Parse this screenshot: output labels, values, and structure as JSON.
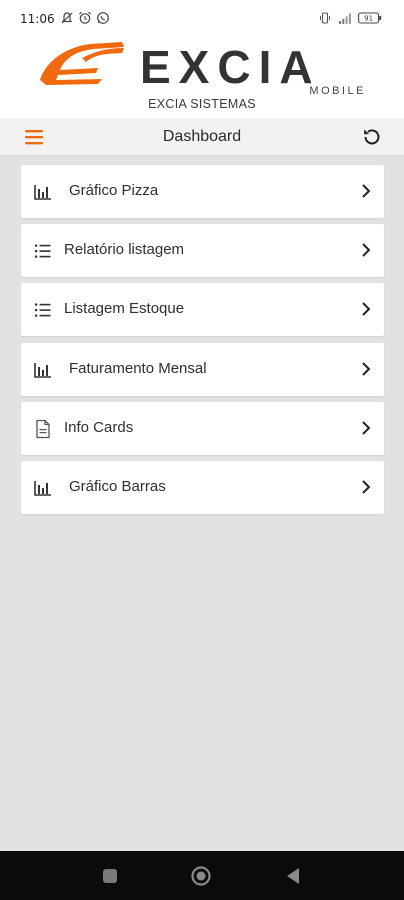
{
  "status_bar": {
    "time": "11:06",
    "left_icons": [
      "notifications-off-icon",
      "alarm-icon",
      "whatsapp-icon"
    ],
    "right_icons": [
      "vibrate-icon",
      "signal-icon",
      "battery-icon"
    ],
    "battery_level": "91"
  },
  "header": {
    "brand_name": "EXCIA",
    "brand_subtitle": "MOBILE",
    "company_name": "EXCIA SISTEMAS",
    "brand_color": "#f26a10",
    "text_color": "#333333"
  },
  "toolbar": {
    "menu_icon": "hamburger-menu-icon",
    "title": "Dashboard",
    "refresh_icon": "refresh-icon"
  },
  "menu_items": [
    {
      "label": "Gráfico Pizza",
      "icon": "bar-chart-icon"
    },
    {
      "label": "Relatório listagem",
      "icon": "list-icon"
    },
    {
      "label": "Listagem Estoque",
      "icon": "list-icon"
    },
    {
      "label": "Faturamento Mensal",
      "icon": "bar-chart-icon"
    },
    {
      "label": "Info Cards",
      "icon": "document-icon"
    },
    {
      "label": "Gráfico Barras",
      "icon": "bar-chart-icon"
    }
  ],
  "nav_bar": {
    "buttons": [
      "recent-apps-button",
      "home-button",
      "back-button"
    ]
  }
}
